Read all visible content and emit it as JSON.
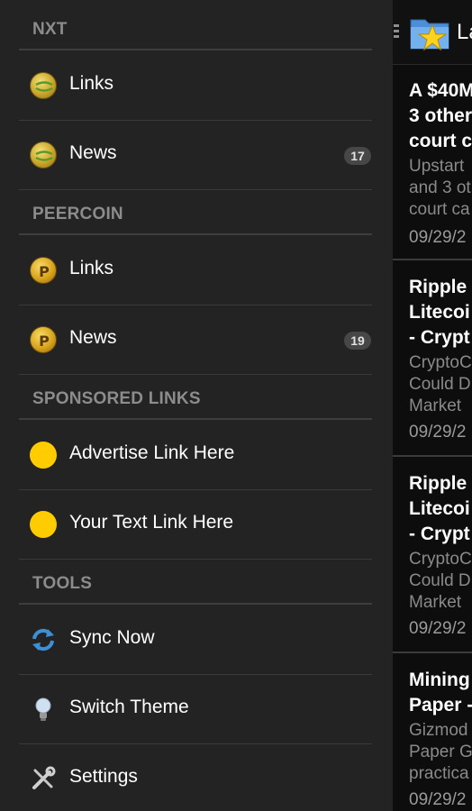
{
  "drawer": {
    "sections": [
      {
        "title": "NXT",
        "items": [
          {
            "label": "Links",
            "icon": "nxt-coin-icon",
            "count": null
          },
          {
            "label": "News",
            "icon": "nxt-coin-icon",
            "count": "17"
          }
        ]
      },
      {
        "title": "PEERCOIN",
        "items": [
          {
            "label": "Links",
            "icon": "peercoin-coin-icon",
            "count": null
          },
          {
            "label": "News",
            "icon": "peercoin-coin-icon",
            "count": "19"
          }
        ]
      },
      {
        "title": "SPONSORED LINKS",
        "items": [
          {
            "label": "Advertise Link Here",
            "icon": "yellow-dot-icon",
            "count": null
          },
          {
            "label": "Your Text Link Here",
            "icon": "yellow-dot-icon",
            "count": null
          }
        ]
      },
      {
        "title": "TOOLS",
        "items": [
          {
            "label": "Sync Now",
            "icon": "sync-icon",
            "count": null
          },
          {
            "label": "Switch Theme",
            "icon": "lightbulb-icon",
            "count": null
          },
          {
            "label": "Settings",
            "icon": "wrench-screwdriver-icon",
            "count": null
          }
        ]
      }
    ]
  },
  "actionbar": {
    "title": "La",
    "icon": "folder-star-icon"
  },
  "articles": [
    {
      "headline": "A $40M\n3 other\ncourt c",
      "snippet": "Upstart\nand 3 ot\ncourt ca",
      "date": "09/29/2"
    },
    {
      "headline": "Ripple\nLitecoi\n- Crypt",
      "snippet": "CryptoC\nCould D\nMarket",
      "date": "09/29/2"
    },
    {
      "headline": "Ripple\nLitecoi\n- Crypt",
      "snippet": "CryptoC\nCould D\nMarket",
      "date": "09/29/2"
    },
    {
      "headline": "Mining\nPaper -",
      "snippet": "Gizmod\nPaper G\npractica",
      "date": "09/29/2"
    }
  ],
  "colors": {
    "drawer_bg": "#232323",
    "section_text": "#8c8c8c",
    "badge_bg": "#474747",
    "sponsored_dot": "#ffcc00"
  }
}
